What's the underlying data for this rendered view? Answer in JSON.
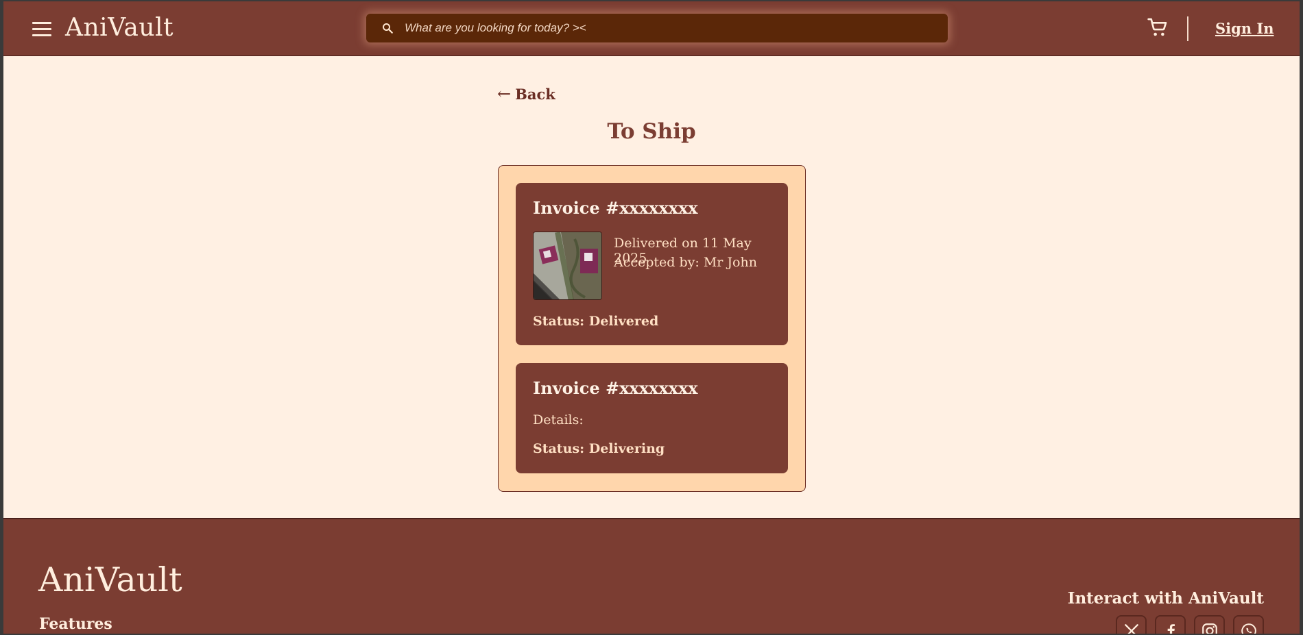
{
  "header": {
    "logo": "AniVault",
    "search_placeholder": "What are you looking for today? ><",
    "sign_in": "Sign In"
  },
  "main": {
    "back_arrow": "←",
    "back_label": "Back",
    "title": "To Ship",
    "orders": [
      {
        "invoice": "Invoice #xxxxxxxx",
        "delivered": "Delivered on 11 May 2025",
        "accepted": "Accepted by: Mr John",
        "status": "Status: Delivered"
      },
      {
        "invoice": "Invoice #xxxxxxxx",
        "details": "Details:",
        "status": "Status: Delivering"
      }
    ]
  },
  "footer": {
    "logo": "AniVault",
    "features": "Features",
    "interact": "Interact with AniVault",
    "socials": [
      "x-icon",
      "facebook-icon",
      "instagram-icon",
      "whatsapp-icon"
    ]
  },
  "colors": {
    "brand": "#7b3d32",
    "background": "#fff0e3",
    "panel": "#ffd6ac",
    "search_bg": "#5b2708"
  }
}
